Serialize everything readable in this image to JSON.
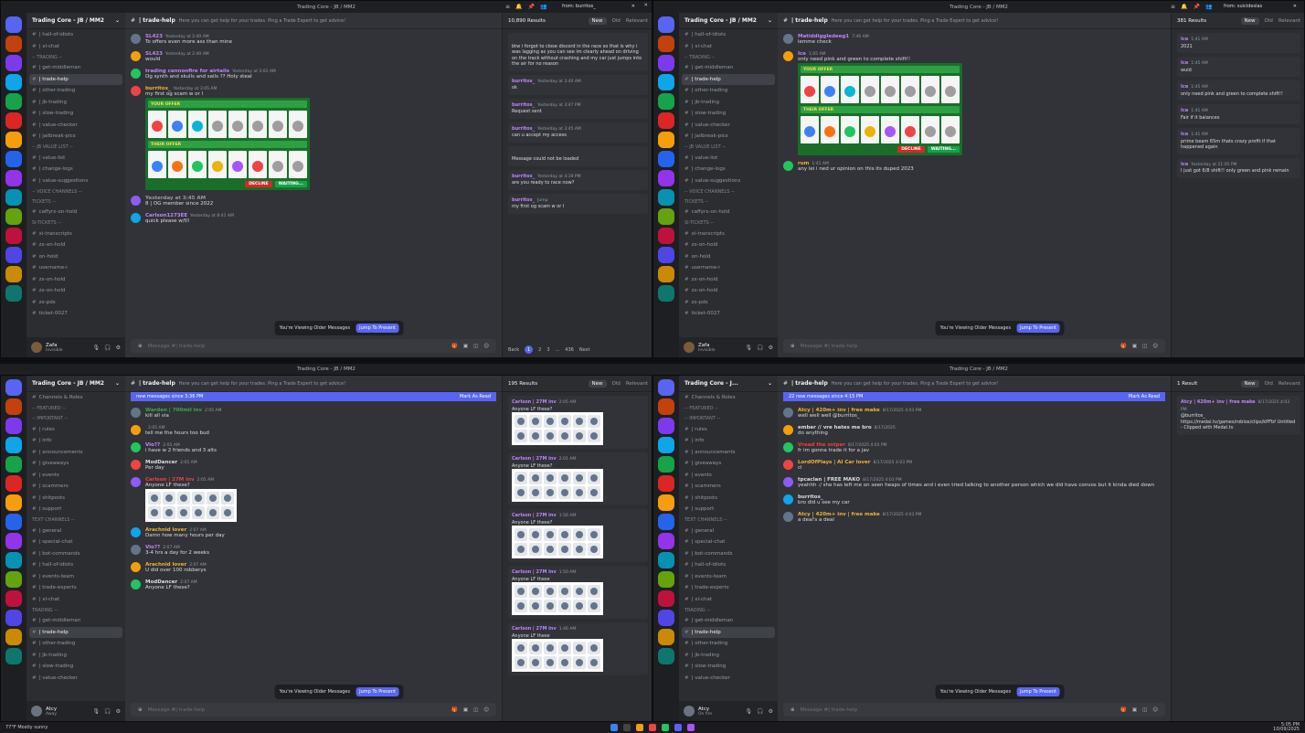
{
  "window_title": "Trading Core - JB / MM2",
  "server_name": "Trading Core - JB / MM2",
  "server_name_short": "Trading Core - J...",
  "channel": {
    "name": "| trade-help",
    "topic": "Here you can get help for your trades. Ping a Trade Expert to get advice!"
  },
  "search_q0": {
    "query": "from: burritos_",
    "results": "10,890 Results"
  },
  "search_q1": {
    "query": "from: suicideslas",
    "results": "381 Results"
  },
  "search_q2": {
    "query": "Anyone lf these",
    "results": "195 Results"
  },
  "search_q3": {
    "query": "from: atcyy  model",
    "results": "1 Result"
  },
  "tabs": {
    "new": "New",
    "old": "Old",
    "relevant": "Relevant"
  },
  "compose_placeholder": "Message #| trade-help",
  "older_messages": "You're Viewing Older Messages",
  "jump_present": "Jump To Present",
  "new_messages_q2": "new messages since 3:36 PM",
  "new_messages_q3": "22 new messages since 4:15 PM",
  "mark_read": "Mark As Read",
  "channels_q0": [
    {
      "label": "| hall-of-idiots",
      "kind": "ch"
    },
    {
      "label": "| xl-chat",
      "kind": "ch"
    },
    {
      "label": "-- TRADING --",
      "kind": "cat"
    },
    {
      "label": "| get-middleman",
      "kind": "ch"
    },
    {
      "label": "| trade-help",
      "kind": "sel"
    },
    {
      "label": "| other-trading",
      "kind": "ch"
    },
    {
      "label": "| jb-trading",
      "kind": "ch"
    },
    {
      "label": "| slow-trading",
      "kind": "ch"
    },
    {
      "label": "| value-checker",
      "kind": "ch"
    },
    {
      "label": "| jailbreak-pics",
      "kind": "ch"
    },
    {
      "label": "-- JB VALUE LIST --",
      "kind": "cat"
    },
    {
      "label": "| value-list",
      "kind": "ch"
    },
    {
      "label": "| change-logs",
      "kind": "ch"
    },
    {
      "label": "| value-suggestions",
      "kind": "ch"
    },
    {
      "label": "-- VOICE CHANNELS --",
      "kind": "cat"
    },
    {
      "label": "TICKETS --",
      "kind": "cat"
    },
    {
      "label": "caffyrx-on-hold",
      "kind": "ch"
    },
    {
      "label": "SI-TICKETS --",
      "kind": "cat"
    },
    {
      "label": "xi-transcripts",
      "kind": "ch"
    },
    {
      "label": "zx-on-hold",
      "kind": "ch"
    },
    {
      "label": "on-hold",
      "kind": "ch"
    },
    {
      "label": "username-i",
      "kind": "ch"
    },
    {
      "label": "zx-on-hold",
      "kind": "ch"
    },
    {
      "label": "zx-on-hold",
      "kind": "ch"
    },
    {
      "label": "zx-pds",
      "kind": "ch"
    },
    {
      "label": "ticket-0027",
      "kind": "ch"
    }
  ],
  "channels_q2": [
    {
      "label": "Channels & Roles",
      "kind": "ch"
    },
    {
      "label": "-- FEATURED --",
      "kind": "cat"
    },
    {
      "label": "-- IMPORTANT --",
      "kind": "cat"
    },
    {
      "label": "| rules",
      "kind": "ch"
    },
    {
      "label": "| info",
      "kind": "ch"
    },
    {
      "label": "| announcements",
      "kind": "ch"
    },
    {
      "label": "| giveaways",
      "kind": "ch"
    },
    {
      "label": "| events",
      "kind": "ch"
    },
    {
      "label": "| scammers",
      "kind": "ch"
    },
    {
      "label": "| shitposts",
      "kind": "ch"
    },
    {
      "label": "| support",
      "kind": "ch"
    },
    {
      "label": "TEXT CHANNELS --",
      "kind": "cat"
    },
    {
      "label": "| general",
      "kind": "ch"
    },
    {
      "label": "| special-chat",
      "kind": "ch"
    },
    {
      "label": "| bot-commands",
      "kind": "ch"
    },
    {
      "label": "| hall-of-idiots",
      "kind": "ch"
    },
    {
      "label": "| events-team",
      "kind": "ch"
    },
    {
      "label": "| trade-experts",
      "kind": "ch"
    },
    {
      "label": "| xl-chat",
      "kind": "ch"
    },
    {
      "label": "TRADING --",
      "kind": "cat"
    },
    {
      "label": "| get-middleman",
      "kind": "ch"
    },
    {
      "label": "| trade-help",
      "kind": "sel"
    },
    {
      "label": "| other-trading",
      "kind": "ch"
    },
    {
      "label": "| jb-trading",
      "kind": "ch"
    },
    {
      "label": "| slow-trading",
      "kind": "ch"
    },
    {
      "label": "| value-checker",
      "kind": "ch"
    }
  ],
  "users": {
    "q0": {
      "name": "Zafa",
      "status": "Invisible"
    },
    "q1": {
      "name": "Zafa",
      "status": "Invisible"
    },
    "q2": {
      "name": "Atcy",
      "status": "Away"
    },
    "q3": {
      "name": "Atcy",
      "status": "On fire"
    }
  },
  "msgs_q0": [
    {
      "name": "SL423",
      "time": "Yesterday at 2:40 AM",
      "text": "To offers even more ass than mine",
      "color": "#c084fc"
    },
    {
      "name": "SL423",
      "time": "Yesterday at 2:40 AM",
      "text": "would",
      "color": "#c084fc"
    },
    {
      "name": "trading cannonfire for airtails",
      "time": "Yesterday at 3:02 AM",
      "text": "Og synth and skulls and sails ?? Holy steal",
      "color": "#c084fc"
    },
    {
      "name": "burritos_",
      "time": "Yesterday at 3:05 AM",
      "text": "my first og scam w or l",
      "color": "#f0b232"
    },
    {
      "name": "Yesterday at 3:45 AM",
      "time": "",
      "text": "8 | OG member since 2022",
      "color": "#949ba4"
    },
    {
      "name": "Carlson1273EE",
      "time": "Yesterday at 8:41 AM",
      "text": "quick please w/f/l",
      "color": "#c084fc"
    }
  ],
  "search_q0_results": [
    {
      "who": "",
      "time": "",
      "text": "btw i forgot to close discord in the race so that is why i was lagging as you can see im clearly ahead on driving on the track without crashing and my car just jumps into the air for no reason"
    },
    {
      "who": "burritos_",
      "time": "Yesterday at 3:40 AM",
      "text": "ok"
    },
    {
      "who": "burritos_",
      "time": "Yesterday at 3:47 PM",
      "text": "Request sent"
    },
    {
      "who": "burritos_",
      "time": "Yesterday at 3:45 AM",
      "text": "can u accept my access"
    },
    {
      "who": "",
      "time": "",
      "text": "Message could not be loaded"
    },
    {
      "who": "burritos_",
      "time": "Yesterday at 4:39 PM",
      "text": "are you ready to race now?"
    },
    {
      "who": "burritos_",
      "time": "Jump",
      "text": "my first og scam w or l"
    }
  ],
  "pagination": {
    "back": "Back",
    "p1": "1",
    "p2": "2",
    "p3": "3",
    "dots": "...",
    "last": "436",
    "next": "Next"
  },
  "msgs_q1": [
    {
      "name": "Matiddiggledeeg1",
      "time": "7:46 AM",
      "text": "lemme check",
      "color": "#c084fc"
    },
    {
      "name": "Ice",
      "time": "1:05 AM",
      "text": "only need pink and green to complete shift!!",
      "color": "#c084fc"
    },
    {
      "name": "rum",
      "time": "1:41 AM",
      "text": "any lei i ned ur opinion on this its duped 2023",
      "color": "#f0b232"
    }
  ],
  "search_q1_results": [
    {
      "who": "Ice",
      "time": "1:41 AM",
      "text": "2021"
    },
    {
      "who": "Ice",
      "time": "1:45 AM",
      "text": "wuld"
    },
    {
      "who": "Ice",
      "time": "1:45 AM",
      "text": "only need pink and green to complete shift!!"
    },
    {
      "who": "Ice",
      "time": "1:41 AM",
      "text": "Fair if it balances"
    },
    {
      "who": "Ice",
      "time": "1:41 AM",
      "text": "prime beam 65m thats crazy profit if that happened again"
    },
    {
      "who": "Ice",
      "time": "Yesterday at 11:05 PM",
      "text": "I just got 6/8 shift!! only green and pink remain"
    }
  ],
  "msgs_q2": [
    {
      "name": "Warden | 700mil inv",
      "time": "2:05 AM",
      "text": "kill all via",
      "color": "#3ba55c"
    },
    {
      "name": "",
      "time": "2:05 AM",
      "text": "tell me the hours too bud",
      "color": "#dbdee1"
    },
    {
      "name": "Vio??",
      "time": "2:05 AM",
      "text": "i have w 2 friends and 3 alts",
      "color": "#c084fc"
    },
    {
      "name": "ModDancer",
      "time": "2:05 AM",
      "text": "Per day",
      "color": "#dbdee1"
    },
    {
      "name": "Carlson | 27M inv",
      "time": "2:05 AM",
      "text": "Anyone LF these?",
      "color": "#f23f43"
    },
    {
      "name": "Arachnid lover",
      "time": "2:07 AM",
      "text": "Damn how many hours per day",
      "color": "#f0b232"
    },
    {
      "name": "Vio??",
      "time": "2:07 AM",
      "text": "3-4 hrs a day for 2 weeks",
      "color": "#c084fc"
    },
    {
      "name": "Arachnid lover",
      "time": "2:07 AM",
      "text": "U did over 100 robberys",
      "color": "#f0b232"
    },
    {
      "name": "ModDancer",
      "time": "2:07 AM",
      "text": "Anyone LF these?",
      "color": "#dbdee1"
    }
  ],
  "search_q2_results": [
    {
      "who": "Carlson | 27M inv",
      "time": "2:05 AM",
      "text": "Anyone LF these?"
    },
    {
      "who": "Carlson | 27M inv",
      "time": "2:01 AM",
      "text": "Anyone LF these?"
    },
    {
      "who": "Carlson | 27M inv",
      "time": "1:56 AM",
      "text": "Anyone LF these?"
    },
    {
      "who": "Carlson | 27M inv",
      "time": "1:50 AM",
      "text": "Anyone LF these"
    },
    {
      "who": "Carlson | 27M inv",
      "time": "1:46 AM",
      "text": "Anyone LF these"
    }
  ],
  "msgs_q3": [
    {
      "name": "Atcy | 420m+ inv | free make",
      "time": "8/17/2025 4:03 PM",
      "text": "well well well @burritos_",
      "color": "#f0b232"
    },
    {
      "name": "ember // vre hates me bro",
      "time": "8/17/2025",
      "text": "do anything",
      "color": "#dbdee1"
    },
    {
      "name": "Vread the sniper",
      "time": "8/17/2025 4:03 PM",
      "text": "fr im gonna trade it for a jav",
      "color": "#f23f43"
    },
    {
      "name": "LordOfPlays | AI Car lover",
      "time": "8/17/2025 4:03 PM",
      "text": "cl",
      "color": "#f0b232"
    },
    {
      "name": "tpcaclan | FREE MAKO",
      "time": "8/17/2025 4:03 PM",
      "text": "yeahhh :/ she has left me on seen heaps of times and i even tried talking to another person which we did have convos but it kinda died down",
      "color": "#dbdee1"
    },
    {
      "name": "burritos_",
      "time": "",
      "text": "bro did u see my car",
      "color": "#dbdee1"
    },
    {
      "name": "Atcy | 420m+ inv | free make",
      "time": "8/17/2025 4:03 PM",
      "text": "a deal's a deal",
      "color": "#f0b232"
    }
  ],
  "search_q3_results": [
    {
      "who": "Atcy | 420m+ inv | free make",
      "time": "8/17/2025 4:03 PM",
      "text": "@burritos_ https://medal.tv/games/roblox/clips/kPFbf Untitled - Clipped with Medal.tv"
    }
  ],
  "trade_ui": {
    "your_offer": "YOUR OFFER",
    "their_offer": "THEIR OFFER",
    "decline": "DECLINE",
    "waiting": "WAITING...",
    "exit": "EXIT",
    "ready": "READY"
  },
  "taskbar": {
    "weather": "77°F",
    "weather_sub": "Mostly sunny",
    "time": "5:05 PM",
    "date": "10/09/2025"
  }
}
